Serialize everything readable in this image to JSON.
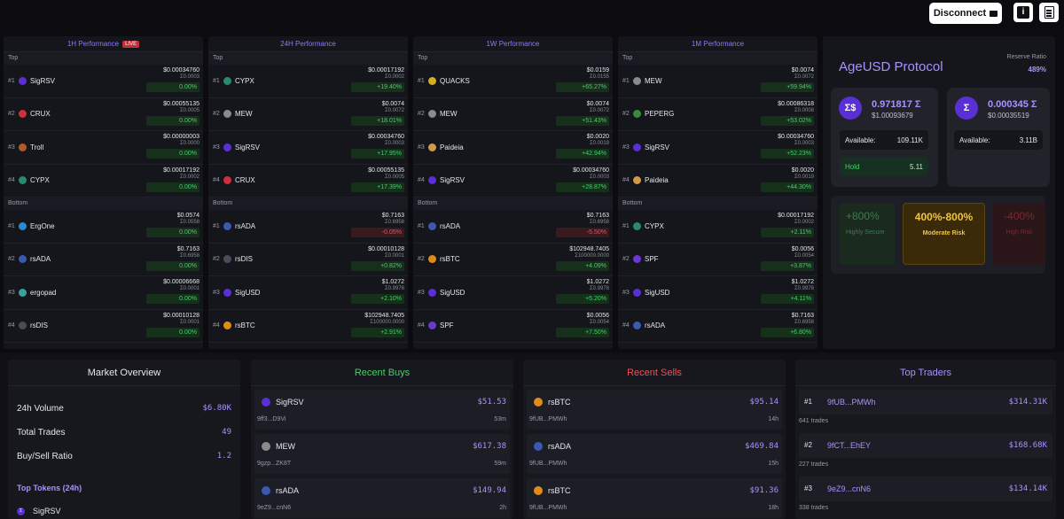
{
  "header": {
    "disconnect_label": "Disconnect",
    "info_icon": "info-icon",
    "docs_icon": "document-icon"
  },
  "perf": [
    {
      "title": "1H Performance",
      "live": "LIVE",
      "top_label": "Top",
      "bottom_label": "Bottom",
      "top": [
        {
          "rank": "#1",
          "name": "SigRSV",
          "price": "$0.00034760",
          "erg": "Σ0.0003",
          "chg": "0.00%",
          "dir": "zero",
          "color": "#5a2fd6"
        },
        {
          "rank": "#2",
          "name": "CRUX",
          "price": "$0.00055135",
          "erg": "Σ0.0005",
          "chg": "0.00%",
          "dir": "zero",
          "color": "#d0303a"
        },
        {
          "rank": "#3",
          "name": "Troll",
          "price": "$0.00000003",
          "erg": "Σ0.0000",
          "chg": "0.00%",
          "dir": "zero",
          "color": "#b05a2a"
        },
        {
          "rank": "#4",
          "name": "CYPX",
          "price": "$0.00017192",
          "erg": "Σ0.0002",
          "chg": "0.00%",
          "dir": "zero",
          "color": "#2a8a6a"
        }
      ],
      "bottom": [
        {
          "rank": "#1",
          "name": "ErgOne",
          "price": "$0.0574",
          "erg": "Σ0.0558",
          "chg": "0.00%",
          "dir": "zero",
          "color": "#2a8ad0"
        },
        {
          "rank": "#2",
          "name": "rsADA",
          "price": "$0.7163",
          "erg": "Σ0.6958",
          "chg": "0.00%",
          "dir": "zero",
          "color": "#3a5ab0"
        },
        {
          "rank": "#3",
          "name": "ergopad",
          "price": "$0.00006668",
          "erg": "Σ0.0001",
          "chg": "0.00%",
          "dir": "zero",
          "color": "#3aa0a0"
        },
        {
          "rank": "#4",
          "name": "rsDIS",
          "price": "$0.00010128",
          "erg": "Σ0.0001",
          "chg": "0.00%",
          "dir": "zero",
          "color": "#4a4a5a"
        }
      ]
    },
    {
      "title": "24H Performance",
      "top_label": "Top",
      "bottom_label": "Bottom",
      "top": [
        {
          "rank": "#1",
          "name": "CYPX",
          "price": "$0.00017192",
          "erg": "Σ0.0002",
          "chg": "+19.40%",
          "dir": "pos",
          "color": "#2a8a6a"
        },
        {
          "rank": "#2",
          "name": "MEW",
          "price": "$0.0074",
          "erg": "Σ0.0072",
          "chg": "+18.01%",
          "dir": "pos",
          "color": "#8a8a8a"
        },
        {
          "rank": "#3",
          "name": "SigRSV",
          "price": "$0.00034760",
          "erg": "Σ0.0003",
          "chg": "+17.95%",
          "dir": "pos",
          "color": "#5a2fd6"
        },
        {
          "rank": "#4",
          "name": "CRUX",
          "price": "$0.00055135",
          "erg": "Σ0.0005",
          "chg": "+17.39%",
          "dir": "pos",
          "color": "#d0303a"
        }
      ],
      "bottom": [
        {
          "rank": "#1",
          "name": "rsADA",
          "price": "$0.7163",
          "erg": "Σ0.6958",
          "chg": "-0.05%",
          "dir": "neg",
          "color": "#3a5ab0"
        },
        {
          "rank": "#2",
          "name": "rsDIS",
          "price": "$0.00010128",
          "erg": "Σ0.0001",
          "chg": "+0.82%",
          "dir": "pos",
          "color": "#4a4a5a"
        },
        {
          "rank": "#3",
          "name": "SigUSD",
          "price": "$1.0272",
          "erg": "Σ0.9978",
          "chg": "+2.10%",
          "dir": "pos",
          "color": "#5a2fd6"
        },
        {
          "rank": "#4",
          "name": "rsBTC",
          "price": "$102948.7405",
          "erg": "Σ100000.0000",
          "chg": "+2.91%",
          "dir": "pos",
          "color": "#e08a1a"
        }
      ]
    },
    {
      "title": "1W Performance",
      "top_label": "Top",
      "bottom_label": "Bottom",
      "top": [
        {
          "rank": "#1",
          "name": "QUACKS",
          "price": "$0.0159",
          "erg": "Σ0.0155",
          "chg": "+65.27%",
          "dir": "pos",
          "color": "#d0b020"
        },
        {
          "rank": "#2",
          "name": "MEW",
          "price": "$0.0074",
          "erg": "Σ0.0072",
          "chg": "+51.43%",
          "dir": "pos",
          "color": "#8a8a8a"
        },
        {
          "rank": "#3",
          "name": "Paideia",
          "price": "$0.0020",
          "erg": "Σ0.0019",
          "chg": "+42.94%",
          "dir": "pos",
          "color": "#d09a4a"
        },
        {
          "rank": "#4",
          "name": "SigRSV",
          "price": "$0.00034760",
          "erg": "Σ0.0003",
          "chg": "+28.87%",
          "dir": "pos",
          "color": "#5a2fd6"
        }
      ],
      "bottom": [
        {
          "rank": "#1",
          "name": "rsADA",
          "price": "$0.7163",
          "erg": "Σ0.6958",
          "chg": "-5.50%",
          "dir": "neg",
          "color": "#3a5ab0"
        },
        {
          "rank": "#2",
          "name": "rsBTC",
          "price": "$102948.7405",
          "erg": "Σ100000.0000",
          "chg": "+4.09%",
          "dir": "pos",
          "color": "#e08a1a"
        },
        {
          "rank": "#3",
          "name": "SigUSD",
          "price": "$1.0272",
          "erg": "Σ0.9978",
          "chg": "+5.20%",
          "dir": "pos",
          "color": "#5a2fd6"
        },
        {
          "rank": "#4",
          "name": "SPF",
          "price": "$0.0056",
          "erg": "Σ0.0054",
          "chg": "+7.50%",
          "dir": "pos",
          "color": "#6a3ad0"
        }
      ]
    },
    {
      "title": "1M Performance",
      "top_label": "Top",
      "bottom_label": "Bottom",
      "top": [
        {
          "rank": "#1",
          "name": "MEW",
          "price": "$0.0074",
          "erg": "Σ0.0072",
          "chg": "+59.94%",
          "dir": "pos",
          "color": "#8a8a8a"
        },
        {
          "rank": "#2",
          "name": "PEPERG",
          "price": "$0.00086318",
          "erg": "Σ0.0008",
          "chg": "+53.02%",
          "dir": "pos",
          "color": "#3a8a3a"
        },
        {
          "rank": "#3",
          "name": "SigRSV",
          "price": "$0.00034760",
          "erg": "Σ0.0003",
          "chg": "+52.23%",
          "dir": "pos",
          "color": "#5a2fd6"
        },
        {
          "rank": "#4",
          "name": "Paideia",
          "price": "$0.0020",
          "erg": "Σ0.0019",
          "chg": "+44.30%",
          "dir": "pos",
          "color": "#d09a4a"
        }
      ],
      "bottom": [
        {
          "rank": "#1",
          "name": "CYPX",
          "price": "$0.00017192",
          "erg": "Σ0.0002",
          "chg": "+2.11%",
          "dir": "pos",
          "color": "#2a8a6a"
        },
        {
          "rank": "#2",
          "name": "SPF",
          "price": "$0.0056",
          "erg": "Σ0.0054",
          "chg": "+3.87%",
          "dir": "pos",
          "color": "#6a3ad0"
        },
        {
          "rank": "#3",
          "name": "SigUSD",
          "price": "$1.0272",
          "erg": "Σ0.9978",
          "chg": "+4.11%",
          "dir": "pos",
          "color": "#5a2fd6"
        },
        {
          "rank": "#4",
          "name": "rsADA",
          "price": "$0.7163",
          "erg": "Σ0.6958",
          "chg": "+6.80%",
          "dir": "pos",
          "color": "#3a5ab0"
        }
      ]
    }
  ],
  "ageusd": {
    "title": "AgeUSD Protocol",
    "reserve_label": "Reserve Ratio",
    "reserve_value": "489%",
    "sigusd": {
      "icon_text": "Σ$",
      "value": "0.971817 Σ",
      "usd": "$1.00093679",
      "available_label": "Available:",
      "available": "109.11K",
      "hold_label": "Hold",
      "hold": "5.11"
    },
    "sigrsv": {
      "icon_text": "Σ",
      "value": "0.000345 Σ",
      "usd": "$0.00035519",
      "available_label": "Available:",
      "available": "3.11B"
    },
    "risk": {
      "secure_big": "+800%",
      "secure_small": "Highly Secure",
      "moderate_big": "400%-800%",
      "moderate_small": "Moderate Risk",
      "high_big": "-400%",
      "high_small": "High Risk"
    }
  },
  "market": {
    "title": "Market Overview",
    "volume_label": "24h Volume",
    "volume": "$6.80K",
    "trades_label": "Total Trades",
    "trades": "49",
    "ratio_label": "Buy/Sell Ratio",
    "ratio": "1.2",
    "top_tokens_label": "Top Tokens (24h)",
    "top_token_1": "SigRSV"
  },
  "buys": {
    "title": "Recent Buys",
    "items": [
      {
        "name": "SigRSV",
        "amount": "$51.53",
        "addr": "9ff3...D9Vi",
        "ago": "53m",
        "color": "#5a2fd6"
      },
      {
        "name": "MEW",
        "amount": "$617.38",
        "addr": "9gzp...ZK8T",
        "ago": "59m",
        "color": "#8a8a8a"
      },
      {
        "name": "rsADA",
        "amount": "$149.94",
        "addr": "9eZ9...cnN6",
        "ago": "2h",
        "color": "#3a5ab0"
      }
    ]
  },
  "sells": {
    "title": "Recent Sells",
    "items": [
      {
        "name": "rsBTC",
        "amount": "$95.14",
        "addr": "9fUB...PMWh",
        "ago": "14h",
        "color": "#e08a1a"
      },
      {
        "name": "rsADA",
        "amount": "$469.84",
        "addr": "9fUB...PMWh",
        "ago": "15h",
        "color": "#3a5ab0"
      },
      {
        "name": "rsBTC",
        "amount": "$91.36",
        "addr": "9fUB...PMWh",
        "ago": "18h",
        "color": "#e08a1a"
      }
    ]
  },
  "traders": {
    "title": "Top Traders",
    "items": [
      {
        "rank": "#1",
        "addr": "9fUB...PMWh",
        "amount": "$314.31K",
        "trades": "641 trades"
      },
      {
        "rank": "#2",
        "addr": "9fCT...EhEY",
        "amount": "$168.68K",
        "trades": "227 trades"
      },
      {
        "rank": "#3",
        "addr": "9eZ9...cnN6",
        "amount": "$134.14K",
        "trades": "338 trades"
      }
    ]
  }
}
